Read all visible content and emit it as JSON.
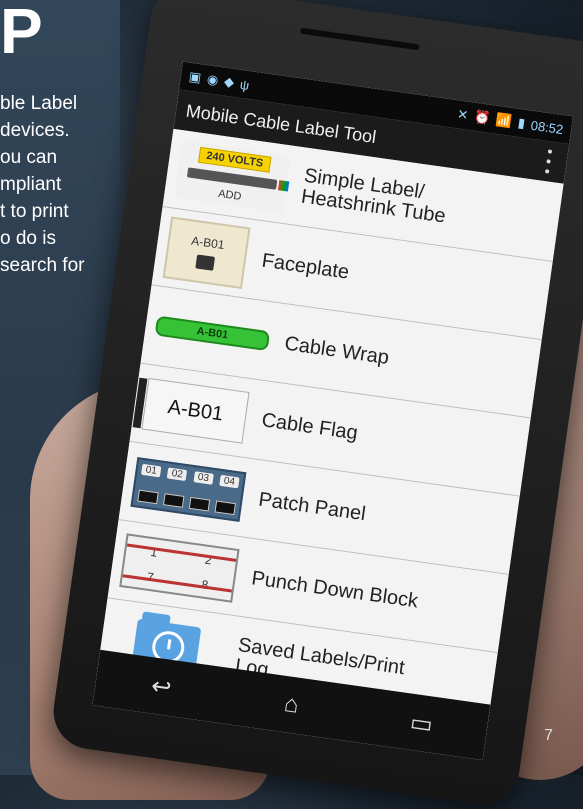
{
  "hero": {
    "headline": "P",
    "lines": [
      "ble Label",
      "devices.",
      "ou can",
      "mpliant",
      "t to print",
      "o do is",
      "search for"
    ]
  },
  "page_number": "7",
  "phone": {
    "status": {
      "time": "08:52"
    },
    "title": "Mobile Cable Label Tool",
    "items": [
      {
        "label": "Simple Label/\nHeatshrink Tube",
        "badge_volt": "240 VOLTS",
        "badge_add": "ADD"
      },
      {
        "label": "Faceplate",
        "code": "A-B01"
      },
      {
        "label": "Cable Wrap",
        "code": "A-B01"
      },
      {
        "label": "Cable Flag",
        "code": "A-B01"
      },
      {
        "label": "Patch Panel",
        "patch_labels": [
          "01",
          "02",
          "03",
          "04"
        ]
      },
      {
        "label": "Punch Down Block",
        "punch_numbers": [
          "1",
          "2",
          "7",
          "8"
        ]
      },
      {
        "label": "Saved Labels/Print\nLog"
      }
    ]
  }
}
